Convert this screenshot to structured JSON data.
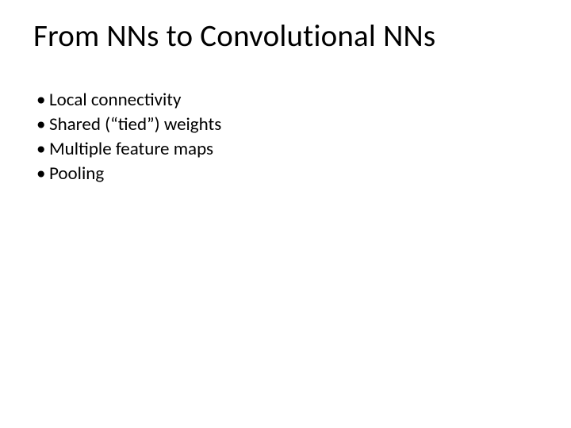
{
  "slide": {
    "title": "From NNs to Convolutional NNs",
    "bullets": [
      "Local connectivity",
      "Shared (“tied”) weights",
      "Multiple feature maps",
      "Pooling"
    ]
  }
}
